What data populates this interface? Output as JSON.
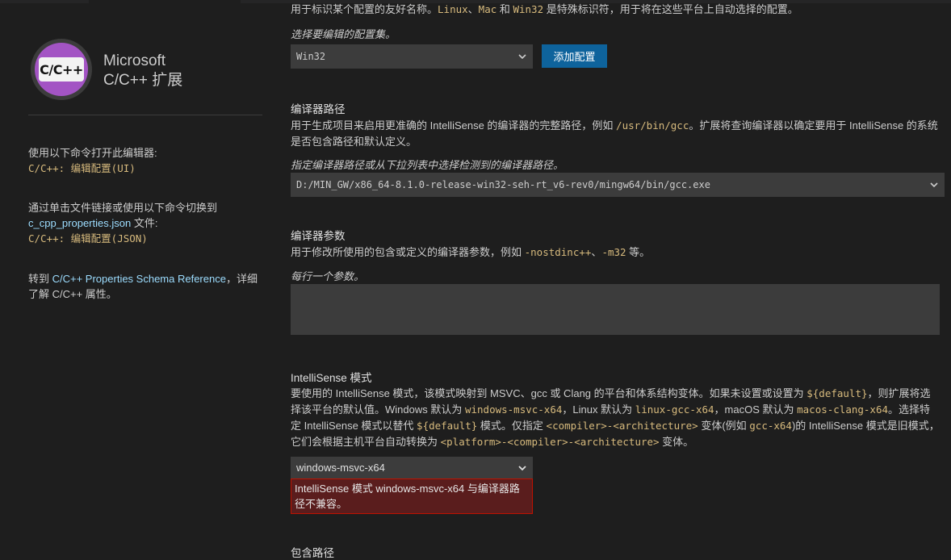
{
  "sidebar": {
    "logo_text": "C/C++",
    "brand_line1": "Microsoft",
    "brand_line2": "C/C++ 扩展",
    "block1_text": "使用以下命令打开此编辑器:",
    "block1_cmd": "C/C++: 编辑配置(UI)",
    "block2_text": "通过单击文件链接或使用以下命令切换到",
    "block2_link": "c_cpp_properties.json",
    "block2_suffix": " 文件:",
    "block2_cmd": "C/C++: 编辑配置(JSON)",
    "block3_prefix": "转到 ",
    "block3_link": "C/C++ Properties Schema Reference",
    "block3_suffix": "，详细了解 C/C++ 属性。"
  },
  "config_name": {
    "desc_prefix": "用于标识某个配置的友好名称。",
    "linux": "Linux",
    "sep1": "、",
    "mac": "Mac",
    "and": " 和 ",
    "win32": "Win32",
    "desc_suffix": " 是特殊标识符，用于将在这些平台上自动选择的配置。",
    "hint": "选择要编辑的配置集。",
    "selected": "Win32",
    "add_button": "添加配置"
  },
  "compiler_path": {
    "title": "编译器路径",
    "desc_a": "用于生成项目来启用更准确的 IntelliSense 的编译器的完整路径，例如 ",
    "example": "/usr/bin/gcc",
    "desc_b": "。扩展将查询编译器以确定要用于 IntelliSense 的系统是否包含路径和默认定义。",
    "hint": "指定编译器路径或从下拉列表中选择检测到的编译器路径。",
    "selected": "D:/MIN_GW/x86_64-8.1.0-release-win32-seh-rt_v6-rev0/mingw64/bin/gcc.exe"
  },
  "compiler_args": {
    "title": "编译器参数",
    "desc_a": "用于修改所使用的包含或定义的编译器参数，例如 ",
    "ex1": "-nostdinc++",
    "sep": "、",
    "ex2": "-m32",
    "desc_b": " 等。",
    "hint": "每行一个参数。",
    "value": ""
  },
  "intellisense": {
    "title": "IntelliSense 模式",
    "p1": "要使用的 IntelliSense 模式，该模式映射到 MSVC、gcc 或 Clang 的平台和体系结构变体。如果未设置或设置为 ",
    "c_default": "${default}",
    "p2": "，则扩展将选择该平台的默认值。Windows 默认为 ",
    "c_win": "windows-msvc-x64",
    "p3": "，Linux 默认为 ",
    "c_linux": "linux-gcc-x64",
    "p4": "，macOS 默认为 ",
    "c_mac": "macos-clang-x64",
    "p5": "。选择特定 IntelliSense 模式以替代 ",
    "c_default2": "${default}",
    "p6": " 模式。仅指定 ",
    "c_ca": "<compiler>-<architecture>",
    "p7": " 变体(例如 ",
    "c_gcc": "gcc-x64",
    "p8": ")的 IntelliSense 模式是旧模式，它们会根据主机平台自动转换为 ",
    "c_pca": "<platform>-<compiler>-<architecture>",
    "p9": " 变体。",
    "selected": "windows-msvc-x64",
    "error": "IntelliSense 模式 windows-msvc-x64 与编译器路径不兼容。"
  },
  "include_path": {
    "title": "包含路径"
  },
  "colors": {
    "background": "#1e1e1e",
    "input": "#3c3c3c",
    "button": "#0e639c",
    "code": "#d7ba7d",
    "link": "#9cdcfe",
    "error_bg": "#5a1d1d",
    "error_border": "#be1100"
  },
  "icons": [
    "cpp-logo-icon",
    "chevron-down-icon",
    "resize-grip-icon"
  ]
}
